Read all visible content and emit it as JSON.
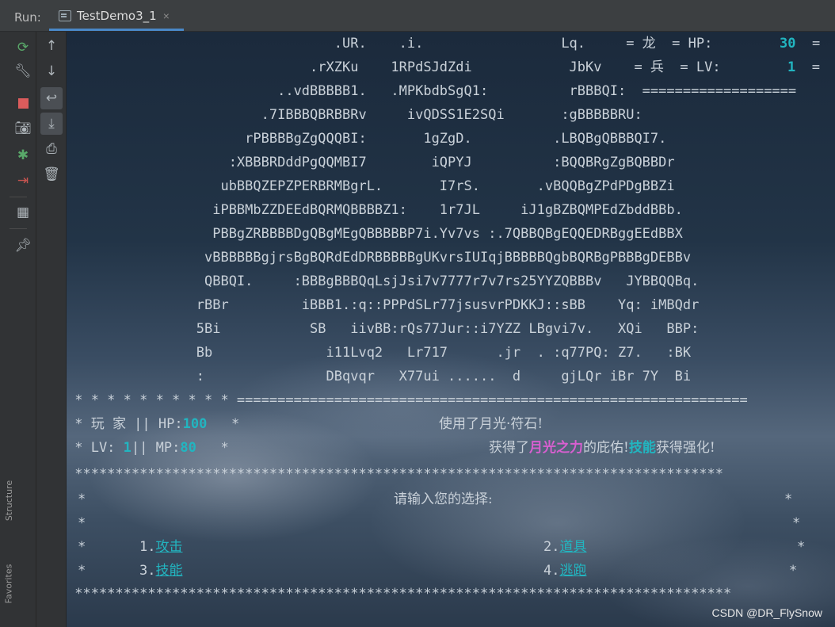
{
  "toolbar": {
    "run_label": "Run:",
    "tab_title": "TestDemo3_1",
    "close_glyph": "×"
  },
  "side": {
    "structure_label": "Structure",
    "favorites_label": "Favorites"
  },
  "console": {
    "art": [
      "                                 .UR.    .i.                 Lq.     = 龙  = HP:",
      "                              .rXZKu    1RPdSJdZdi            JbKv    = 兵  = LV:",
      "                          ..vdBBBBB1.   .MPKbdbSgQ1:          rBBBQI:  ===================",
      "                        .7IBBBQBRBBRv     ivQDSS1E2SQi       :gBBBBBRU:",
      "                      rPBBBBgZgQQQBI:       1gZgD.          .LBQBgQBBBQI7.",
      "                    :XBBBRDddPgQQMBI7        iQPYJ          :BQQBRgZgBQBBDr",
      "                   ubBBQZEPZPERBRMBgrL.       I7rS.       .vBQQBgZPdPDgBBZi",
      "                  iPBBMbZZDEEdBQRMQBBBBZ1:    1r7JL     iJ1gBZBQMPEdZbddBBb.",
      "                  PBBgZRBBBBDgQBgMEgQBBBBBP7i.Yv7vs :.7QBBQBgEQQEDRBggEEdBBX",
      "                 vBBBBBBgjrsBgBQRdEdDRBBBBBgUKvrsIUIqjBBBBBQgbBQRBgPBBBgDEBBv",
      "                 QBBQI.     :BBBgBBBQqLsjJsi7v7777r7v7rs25YYZQBBBv   JYBBQQBq.",
      "                rBBr         iBBB1.:q::PPPdSLr77jsusvrPDKKJ::sBB    Yq: iMBQdr",
      "                5Bi           SB   iivBB:rQs77Jur::i7YZZ LBgvi7v.   XQi   BBP:",
      "                Bb              i11Lvq2   Lr717      .jr  . :q77PQ: Z7.   :BK",
      "                :               DBqvqr   X77ui ......  d     gjLQr iBr 7Y  Bi"
    ],
    "hp_value": "30",
    "lv_value": "1",
    "hp_tail": "  =",
    "lv_tail": "  =",
    "sep_line": " * * * * * * * * * * ===============================================================",
    "player_prefix": " * 玩 家 || HP:",
    "player_hp": "100",
    "player_mid": "   *",
    "used_text": "使用了月光·符石!",
    "lv_prefix": " * LV: ",
    "player_lv": "1",
    "mp_prefix": "|| MP:",
    "player_mp": "80",
    "lv_mid": "   *",
    "gain_pre": "获得了",
    "gain_moon": "月光之力",
    "gain_mid": "的庇佑!",
    "gain_skill": "技能",
    "gain_post": "获得强化!",
    "star_line": " ********************************************************************************",
    "star_line_long": " *********************************************************************************",
    "prompt": "请输入您的选择:",
    "star": "*",
    "options": [
      {
        "num": "1.",
        "label": "攻击"
      },
      {
        "num": "2.",
        "label": "道具"
      },
      {
        "num": "3.",
        "label": "技能"
      },
      {
        "num": "4.",
        "label": "逃跑"
      }
    ]
  },
  "watermark": "CSDN @DR_FlySnow"
}
